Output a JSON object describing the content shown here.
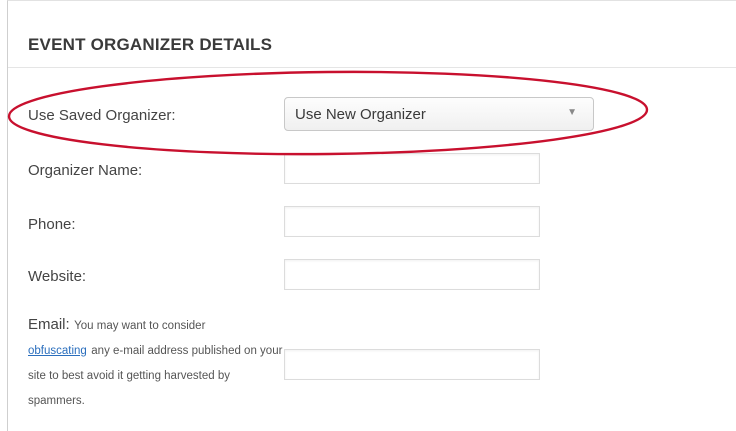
{
  "section": {
    "title": "EVENT ORGANIZER DETAILS"
  },
  "saved_organizer": {
    "label": "Use Saved Organizer:",
    "selected": "Use New Organizer",
    "arrow": "▼"
  },
  "organizer_name": {
    "label": "Organizer Name:",
    "value": ""
  },
  "phone": {
    "label": "Phone:",
    "value": ""
  },
  "website": {
    "label": "Website:",
    "value": ""
  },
  "email": {
    "label": "Email:",
    "note_before": "You may want to consider",
    "link": "obfuscating",
    "note_after": "any e-mail address published on your site to best avoid it getting harvested by spammers.",
    "value": ""
  },
  "annotation": {
    "color": "#c8102e"
  }
}
